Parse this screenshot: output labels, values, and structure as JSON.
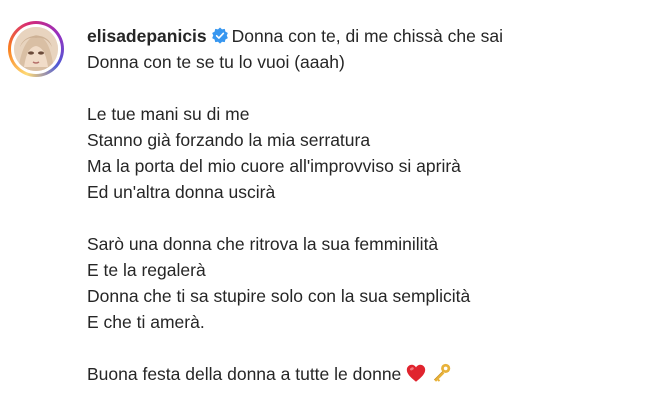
{
  "post": {
    "username": "elisadepanicis",
    "verified_icon": "verified-badge-icon",
    "caption_lines": [
      "Donna con te, di me chissà che sai",
      "Donna con te se tu lo vuoi (aaah)",
      "",
      "Le tue mani su di me",
      "Stanno già forzando la mia serratura",
      "Ma la porta del mio cuore all'improvviso si aprirà",
      "Ed un'altra donna uscirà",
      "",
      "Sarò una donna che ritrova la sua femminilità",
      "E te la regalerà",
      "Donna che ti sa stupire solo con la sua semplicità",
      "E che ti amerà.",
      "",
      "Buona festa della donna a tutte le donne"
    ],
    "emojis": [
      "heart-emoji-icon",
      "key-emoji-icon"
    ]
  },
  "colors": {
    "text": "#262626",
    "verified_blue": "#3897f0",
    "heart_red": "#e0242e",
    "key_gold": "#e8b23a"
  }
}
